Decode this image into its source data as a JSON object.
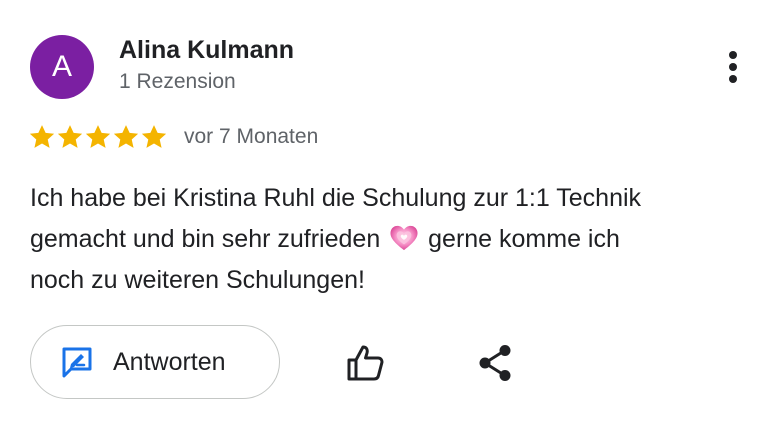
{
  "review": {
    "author": {
      "initial": "A",
      "name": "Alina Kulmann",
      "review_count": "1 Rezension",
      "avatar_color": "#7b1fa2"
    },
    "rating": 5,
    "rating_max": 5,
    "star_color": "#f4b400",
    "date": "vor 7 Monaten",
    "text": {
      "line1": "Ich habe bei Kristina Ruhl die Schulung zur 1:1 Technik",
      "line2_before": "gemacht und bin sehr zufrieden",
      "emoji": "growing-heart-emoji",
      "line2_after": "gerne komme ich",
      "line3": "noch zu weiteren Schulungen!"
    }
  },
  "actions": {
    "reply_label": "Antworten",
    "reply_icon": "reply-edit-icon",
    "like_icon": "thumbs-up-icon",
    "share_icon": "share-icon",
    "more_icon": "more-vert-icon",
    "accent_color": "#1a73e8"
  }
}
